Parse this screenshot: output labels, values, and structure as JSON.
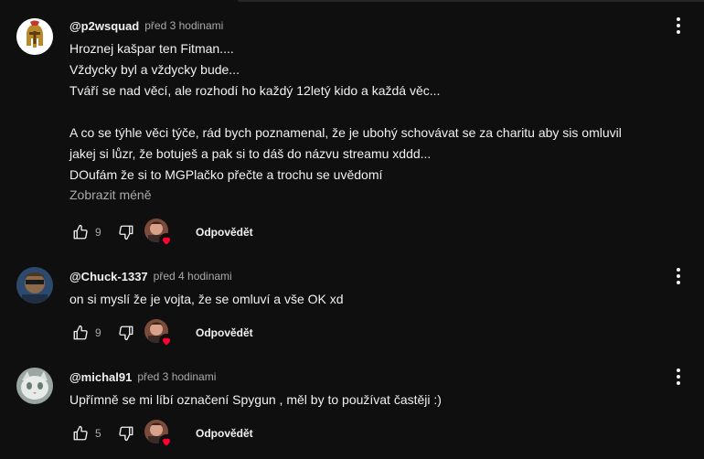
{
  "comments": [
    {
      "author": "@p2wsquad",
      "time": "před 3 hodinami",
      "lines": [
        "Hroznej kašpar ten Fitman....",
        "Vždycky byl a vždycky bude...",
        "Tváří se nad věcí, ale rozhodí ho každý 12letý kido a každá věc...",
        "",
        "A co se týhle věci týče, rád bych poznamenal, že je ubohý schovávat se za charitu aby sis omluvil",
        "jakej si lůzr, že botuješ a pak si to dáš do názvu streamu xddd...",
        "DOufám že si to MGPlačko přečte a trochu se uvědomí"
      ],
      "show_less": "Zobrazit méně",
      "likes": "9",
      "reply": "Odpovědět",
      "avatar_icon": "spartan-helmet-icon"
    },
    {
      "author": "@Chuck-1337",
      "time": "před 4 hodinami",
      "lines": [
        "on si myslí že je vojta, že se omluví a vše OK xd"
      ],
      "likes": "9",
      "reply": "Odpovědět",
      "avatar_icon": "person-avatar-icon"
    },
    {
      "author": "@michal91",
      "time": "před 3 hodinami",
      "lines": [
        "Upřímně se mi líbí označení Spygun , měl by to používat častěji :)"
      ],
      "likes": "5",
      "reply": "Odpovědět",
      "avatar_icon": "cat-avatar-icon"
    }
  ],
  "icons": {
    "like": "thumbs-up-icon",
    "dislike": "thumbs-down-icon",
    "more": "more-vert-icon",
    "creator_heart": "creator-heart-icon"
  },
  "colors": {
    "background": "#0f0f0f",
    "text_primary": "#f1f1f1",
    "text_secondary": "#aaaaaa",
    "heart": "#ff0033"
  }
}
